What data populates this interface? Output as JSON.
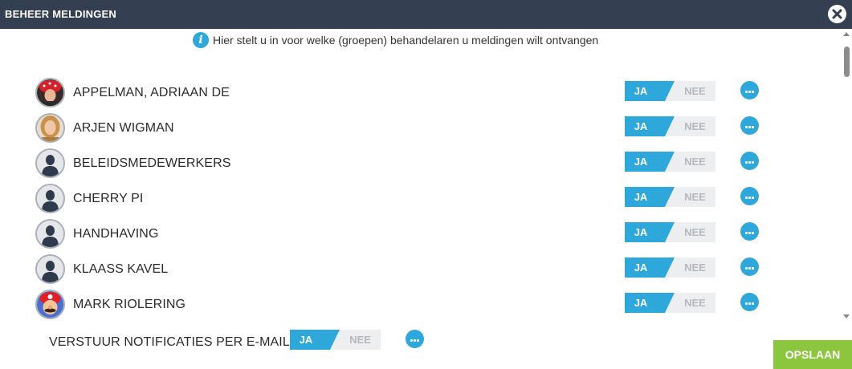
{
  "window": {
    "title": "BEHEER MELDINGEN",
    "close_icon": "close-icon"
  },
  "info": {
    "icon": "info-icon",
    "text": "Hier stelt u in voor welke (groepen) behandelaren u meldingen wilt ontvangen"
  },
  "toggle": {
    "yes_label": "JA",
    "no_label": "NEE",
    "active_color": "#2ea8db",
    "inactive_color": "#eceef0"
  },
  "recipients": [
    {
      "name": "APPELMAN, ADRIAAN DE",
      "avatar": "photo-red-hat",
      "selected": "JA"
    },
    {
      "name": "ARJEN WIGMAN",
      "avatar": "photo-blonde",
      "selected": "JA"
    },
    {
      "name": "BELEIDSMEDEWERKERS",
      "avatar": "default-person",
      "selected": "JA"
    },
    {
      "name": "CHERRY PI",
      "avatar": "default-person",
      "selected": "JA"
    },
    {
      "name": "HANDHAVING",
      "avatar": "default-person",
      "selected": "JA"
    },
    {
      "name": "KLAASS KAVEL",
      "avatar": "default-person",
      "selected": "JA"
    },
    {
      "name": "MARK RIOLERING",
      "avatar": "photo-mario",
      "selected": "JA"
    }
  ],
  "email": {
    "label": "VERSTUUR NOTIFICATIES PER E-MAIL",
    "selected": "JA"
  },
  "actions": {
    "save_label": "OPSLAAN",
    "save_color": "#8cc63f"
  }
}
